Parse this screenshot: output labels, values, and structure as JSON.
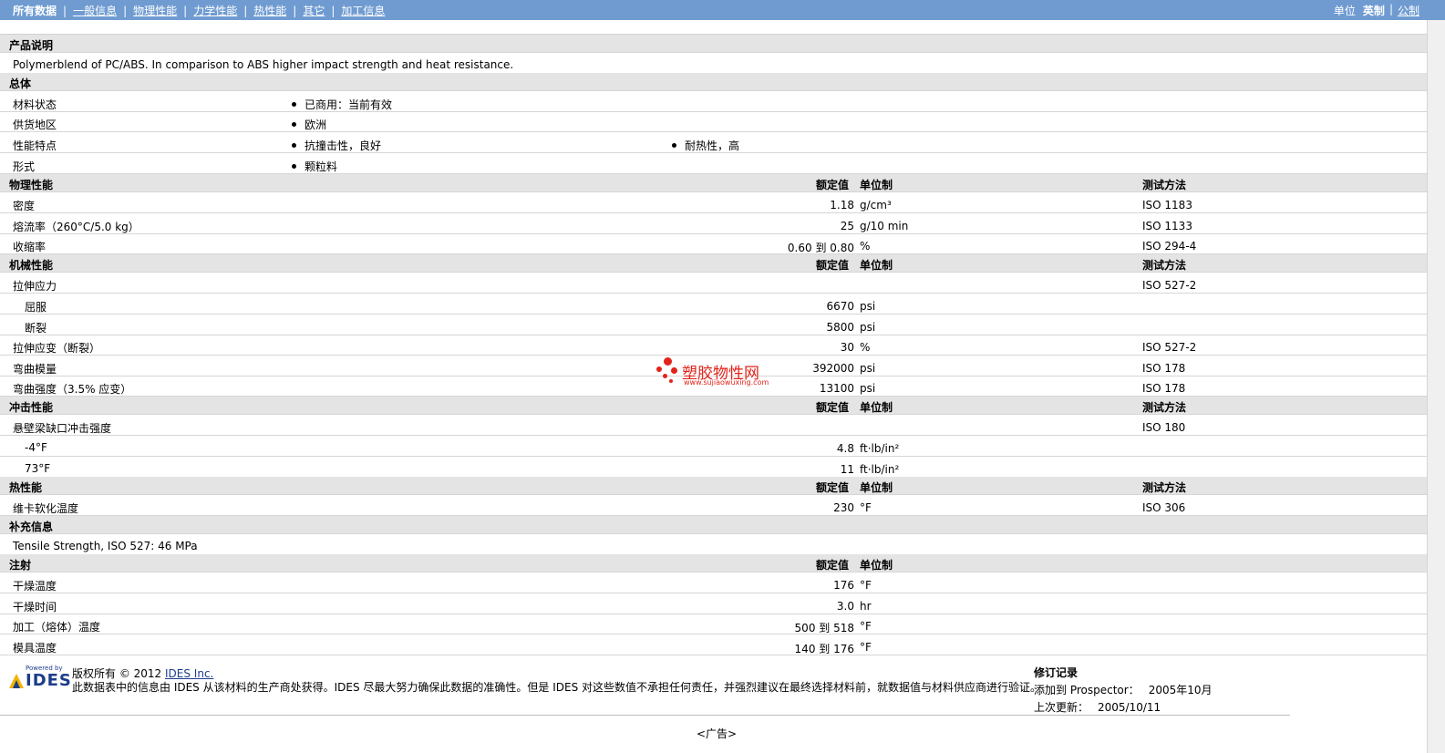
{
  "nav": {
    "items": [
      {
        "label": "所有数据",
        "bold": true
      },
      {
        "label": "一般信息"
      },
      {
        "label": "物理性能"
      },
      {
        "label": "力学性能"
      },
      {
        "label": "热性能"
      },
      {
        "label": "其它"
      },
      {
        "label": "加工信息"
      }
    ],
    "unit_label": "单位",
    "unit_english": "英制",
    "unit_metric": "公制"
  },
  "columns": {
    "nominal": "额定值",
    "unit": "单位制",
    "method": "测试方法"
  },
  "sections": {
    "product_desc": {
      "title": "产品说明",
      "text": "Polymerblend of PC/ABS. In comparison to ABS higher impact strength and heat resistance."
    },
    "general": {
      "title": "总体",
      "rows": [
        {
          "label": "材料状态",
          "items": [
            "已商用：当前有效"
          ]
        },
        {
          "label": "供货地区",
          "items": [
            "欧洲"
          ]
        },
        {
          "label": "性能特点",
          "items": [
            "抗撞击性，良好",
            "耐热性，高"
          ]
        },
        {
          "label": "形式",
          "items": [
            "颗粒料"
          ]
        }
      ]
    },
    "physical": {
      "title": "物理性能",
      "rows": [
        {
          "label": "密度",
          "value": "1.18",
          "unit": "g/cm³",
          "method": "ISO 1183"
        },
        {
          "label": "熔流率（260°C/5.0 kg）",
          "value": "25",
          "unit": "g/10 min",
          "method": "ISO 1133"
        },
        {
          "label": "收缩率",
          "value": "0.60 到  0.80",
          "unit": "%",
          "method": "ISO 294-4"
        }
      ]
    },
    "mechanical": {
      "title": "机械性能",
      "rows": [
        {
          "label": "拉伸应力",
          "value": "",
          "unit": "",
          "method": "ISO 527-2"
        },
        {
          "label": "屈服",
          "value": "6670",
          "unit": "psi",
          "method": "",
          "sub": true
        },
        {
          "label": "断裂",
          "value": "5800",
          "unit": "psi",
          "method": "",
          "sub": true
        },
        {
          "label": "拉伸应变（断裂）",
          "value": "30",
          "unit": "%",
          "method": "ISO 527-2"
        },
        {
          "label": "弯曲模量",
          "value": "392000",
          "unit": "psi",
          "method": "ISO 178"
        },
        {
          "label": "弯曲强度（3.5% 应变）",
          "value": "13100",
          "unit": "psi",
          "method": "ISO 178"
        }
      ]
    },
    "impact": {
      "title": "冲击性能",
      "rows": [
        {
          "label": "悬壁梁缺口冲击强度",
          "value": "",
          "unit": "",
          "method": "ISO 180"
        },
        {
          "label": "-4°F",
          "value": "4.8",
          "unit": "ft·lb/in²",
          "method": "",
          "sub": true
        },
        {
          "label": "73°F",
          "value": "11",
          "unit": "ft·lb/in²",
          "method": "",
          "sub": true
        }
      ]
    },
    "thermal": {
      "title": "热性能",
      "rows": [
        {
          "label": "维卡软化温度",
          "value": "230",
          "unit": "°F",
          "method": "ISO 306"
        }
      ]
    },
    "supplement": {
      "title": "补充信息",
      "text": "Tensile Strength, ISO 527: 46 MPa"
    },
    "injection": {
      "title": "注射",
      "rows": [
        {
          "label": "干燥温度",
          "value": "176",
          "unit": "°F"
        },
        {
          "label": "干燥时间",
          "value": "3.0",
          "unit": "hr"
        },
        {
          "label": "加工（熔体）温度",
          "value": "500 到  518",
          "unit": "°F"
        },
        {
          "label": "模具温度",
          "value": "140 到  176",
          "unit": "°F"
        }
      ]
    }
  },
  "watermark": {
    "brand": "塑胶物性网",
    "url": "www.sujiaowuxing.com"
  },
  "footer": {
    "logo_powered": "Powered by",
    "logo_name": "IDES",
    "copyright_prefix": "版权所有 © 2012",
    "copyright_link": "IDES Inc.",
    "disclaimer": "此数据表中的信息由 IDES 从该材料的生产商处获得。IDES 尽最大努力确保此数据的准确性。但是 IDES 对这些数值不承担任何责任，并强烈建议在最终选择材料前，就数据值与材料供应商进行验证。",
    "revision_title": "修订记录",
    "added_label": "添加到 Prospector：",
    "added_value": "2005年10月",
    "updated_label": "上次更新：",
    "updated_value": "2005/10/11",
    "ad": "<广告>"
  }
}
